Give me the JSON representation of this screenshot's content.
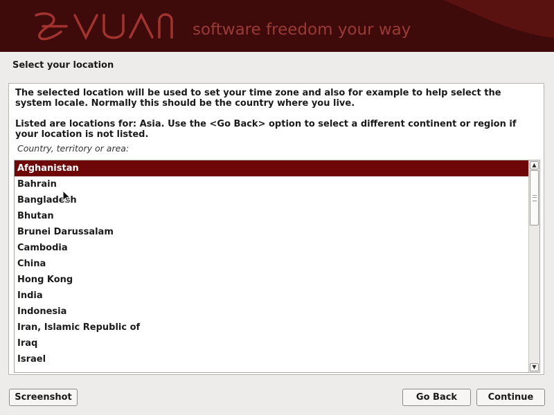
{
  "window": {
    "brand": "DEVUAN",
    "tagline": "software freedom your way",
    "colors": {
      "banner_bg": "#3e0a0a",
      "accent": "#6e0707",
      "tagline": "#9a3a36"
    }
  },
  "page": {
    "title": "Select your location",
    "paragraph1": "The selected location will be used to set your time zone and also for example to help select the system locale. Normally this should be the country where you live.",
    "paragraph2": "Listed are locations for: Asia. Use the <Go Back> option to select a different continent or region if your location is not listed.",
    "list_label": "Country, territory or area:"
  },
  "list": {
    "selected_index": 0,
    "items": [
      "Afghanistan",
      "Bahrain",
      "Bangladesh",
      "Bhutan",
      "Brunei Darussalam",
      "Cambodia",
      "China",
      "Hong Kong",
      "India",
      "Indonesia",
      "Iran, Islamic Republic of",
      "Iraq",
      "Israel"
    ]
  },
  "buttons": {
    "screenshot": "Screenshot",
    "go_back": "Go Back",
    "continue": "Continue"
  },
  "icons": {
    "scroll_up": "chevron-up-icon",
    "scroll_down": "chevron-down-icon",
    "cursor": "mouse-pointer-icon"
  }
}
